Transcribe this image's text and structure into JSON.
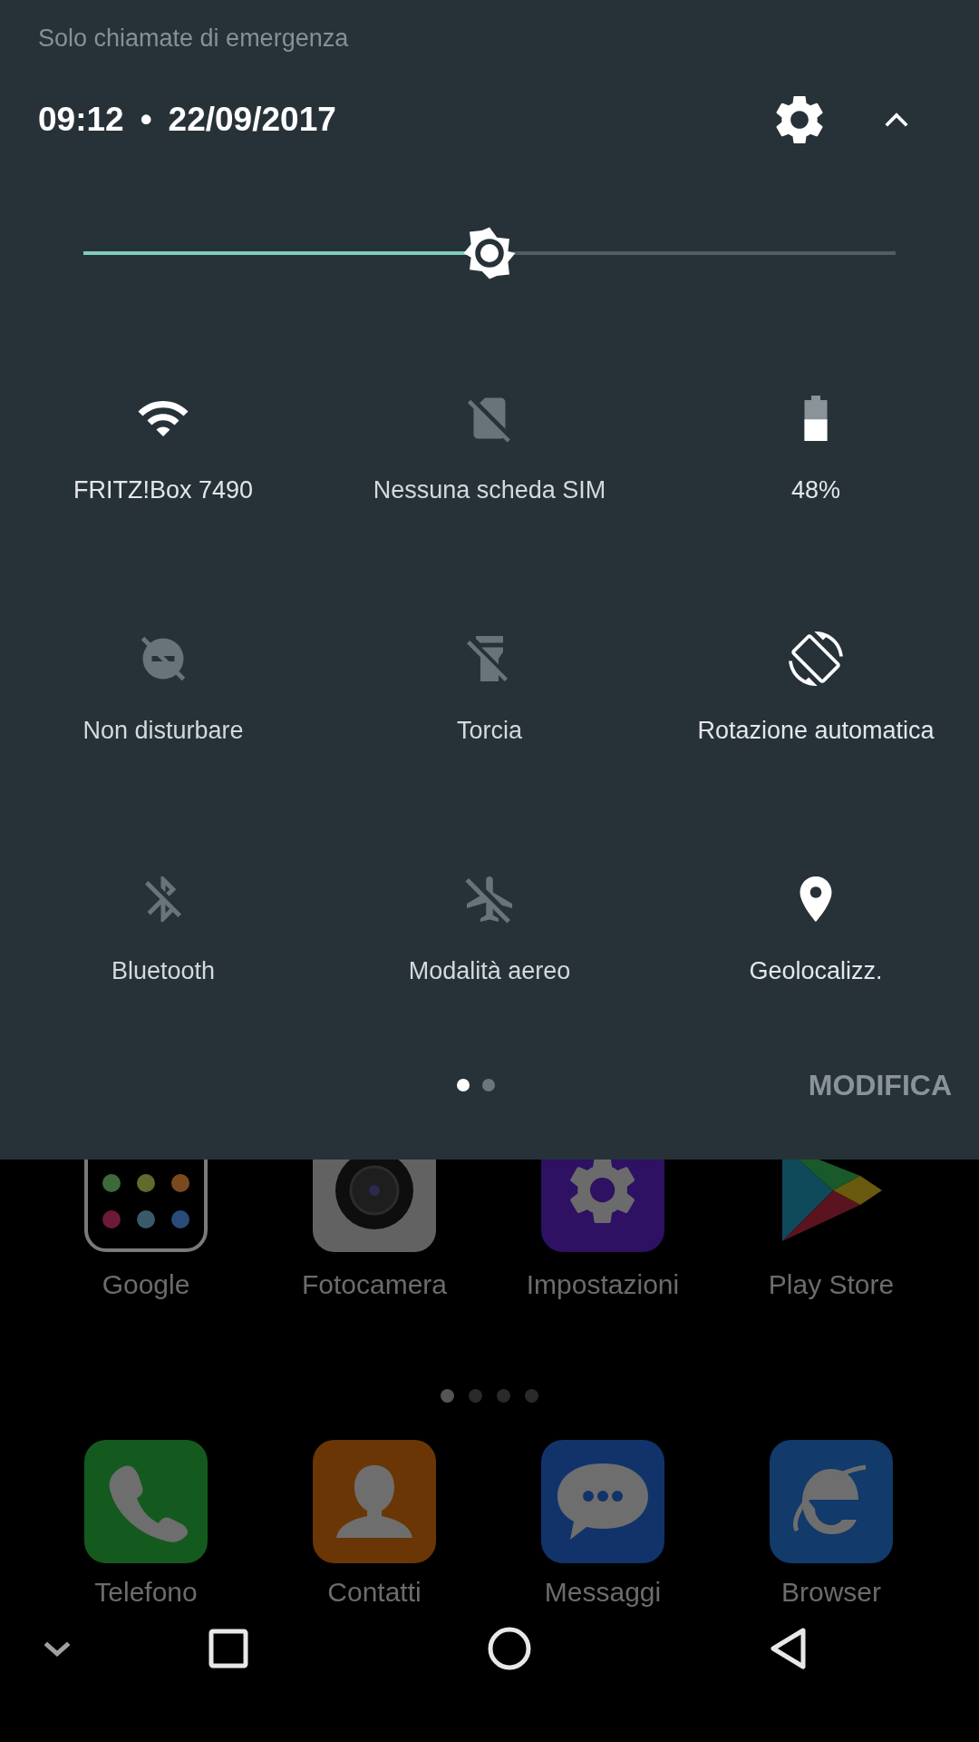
{
  "status_text": "Solo chiamate di emergenza",
  "header": {
    "time": "09:12",
    "separator": "•",
    "date": "22/09/2017"
  },
  "brightness": {
    "level": 0.5
  },
  "tiles": [
    {
      "kind": "wifi",
      "label": "FRITZ!Box 7490",
      "on": true
    },
    {
      "kind": "sim",
      "label": "Nessuna scheda SIM",
      "on": false
    },
    {
      "kind": "battery",
      "label": "48%",
      "on": true
    },
    {
      "kind": "dnd",
      "label": "Non disturbare",
      "on": false
    },
    {
      "kind": "flashlight",
      "label": "Torcia",
      "on": false
    },
    {
      "kind": "rotation",
      "label": "Rotazione automatica",
      "on": true
    },
    {
      "kind": "bluetooth",
      "label": "Bluetooth",
      "on": false
    },
    {
      "kind": "airplane",
      "label": "Modalità aereo",
      "on": false
    },
    {
      "kind": "location",
      "label": "Geolocalizz.",
      "on": true
    }
  ],
  "pages": [
    {
      "selected": true
    },
    {
      "selected": false
    }
  ],
  "edit_button": "MODIFICA",
  "home": {
    "apps": [
      {
        "kind": "folder",
        "label": "Google"
      },
      {
        "kind": "camera",
        "label": "Fotocamera"
      },
      {
        "kind": "settings",
        "label": "Impostazioni"
      },
      {
        "kind": "store",
        "label": "Play Store"
      }
    ],
    "pages": [
      {
        "selected": true
      },
      {
        "selected": false
      },
      {
        "selected": false
      },
      {
        "selected": false
      }
    ],
    "dock": [
      {
        "kind": "phone",
        "label": "Telefono"
      },
      {
        "kind": "contacts",
        "label": "Contatti"
      },
      {
        "kind": "messages",
        "label": "Messaggi"
      },
      {
        "kind": "browser",
        "label": "Browser"
      }
    ]
  }
}
